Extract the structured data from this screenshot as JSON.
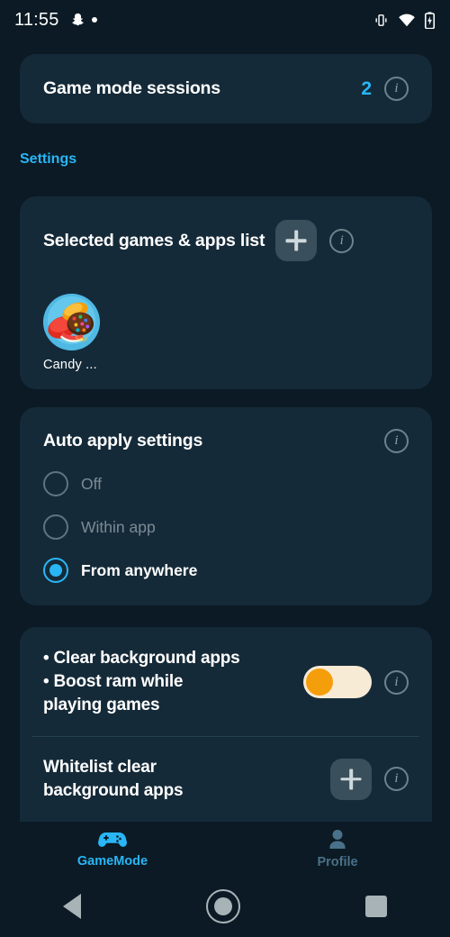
{
  "statusbar": {
    "time": "11:55",
    "icons": [
      "snapchat-ghost-icon",
      "notification-dot-icon"
    ],
    "right_icons": [
      "vibrate-icon",
      "wifi-icon",
      "battery-charging-icon"
    ]
  },
  "sessions_card": {
    "title": "Game mode sessions",
    "count": "2",
    "info_label": "i"
  },
  "section": {
    "header": "Settings"
  },
  "games_card": {
    "title": "Selected games & apps list",
    "add_label": "+",
    "info_label": "i",
    "apps": [
      {
        "name": "Candy ...",
        "icon": "candy-crush-icon"
      }
    ]
  },
  "auto_apply_card": {
    "title": "Auto apply settings",
    "info_label": "i",
    "options": [
      {
        "label": "Off",
        "selected": false
      },
      {
        "label": "Within app",
        "selected": false
      },
      {
        "label": "From anywhere",
        "selected": true
      }
    ]
  },
  "boost_card": {
    "bullets": [
      "• Clear background apps",
      "• Boost ram while",
      "playing games"
    ],
    "toggle_state": "off",
    "info_label": "i",
    "whitelist": {
      "lines": [
        "Whitelist clear",
        "background apps"
      ],
      "add_label": "+",
      "info_label": "i"
    }
  },
  "tabbar": {
    "tabs": [
      {
        "label": "GameMode",
        "icon": "gamepad-icon",
        "active": true
      },
      {
        "label": "Profile",
        "icon": "person-icon",
        "active": false
      }
    ]
  },
  "sysnav": {
    "buttons": [
      "back-triangle-icon",
      "home-circle-icon",
      "recents-square-icon"
    ]
  },
  "colors": {
    "page_background": "#0b1a24",
    "card_background": "#152a38",
    "accent_cyan": "#29b6f6",
    "toggle_thumb_orange": "#f59e0b",
    "toggle_track_cream": "#f7ebd6",
    "muted_text": "#7b8b95",
    "inactive_tab": "#4a7189"
  }
}
